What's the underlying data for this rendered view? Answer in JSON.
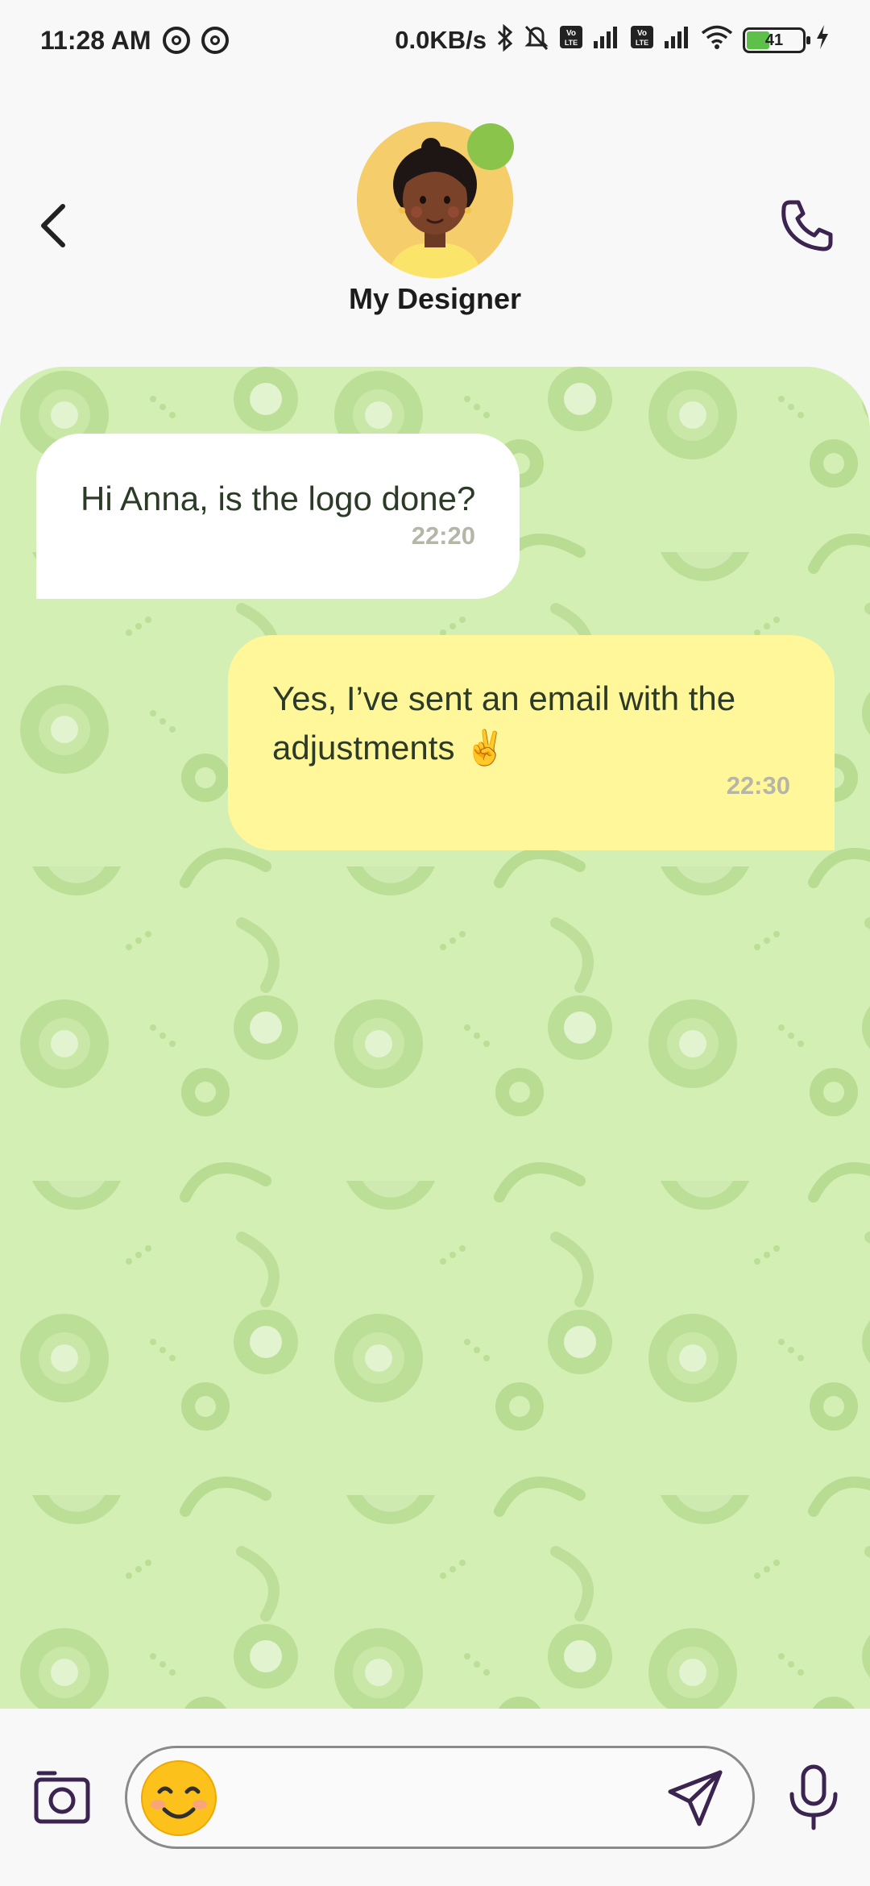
{
  "status_bar": {
    "time": "11:28 AM",
    "net_speed": "0.0KB/s",
    "battery_level": "41",
    "icons": [
      "hotspot-icon",
      "hotspot-icon",
      "bluetooth-icon",
      "mute-icon",
      "volte-icon",
      "signal-icon",
      "volte-icon",
      "signal-icon",
      "wifi-icon",
      "battery-icon",
      "charging-icon"
    ]
  },
  "header": {
    "contact_name": "My Designer",
    "online": true,
    "icons": [
      "back-icon",
      "phone-icon"
    ]
  },
  "colors": {
    "chat_bg": "#d3efb4",
    "incoming_bubble": "#ffffff",
    "outgoing_bubble": "#fff79a",
    "online_dot": "#8ac44a",
    "icon_purple": "#3b2450"
  },
  "messages": [
    {
      "direction": "incoming",
      "text": "Hi Anna, is the logo done?",
      "time": "22:20"
    },
    {
      "direction": "outgoing",
      "text": "Yes, I’ve sent an email with the adjustments ✌️",
      "time": "22:30"
    }
  ],
  "composer": {
    "placeholder": "",
    "value": "",
    "icons": [
      "camera-icon",
      "emoji-icon",
      "send-icon",
      "microphone-icon"
    ]
  }
}
